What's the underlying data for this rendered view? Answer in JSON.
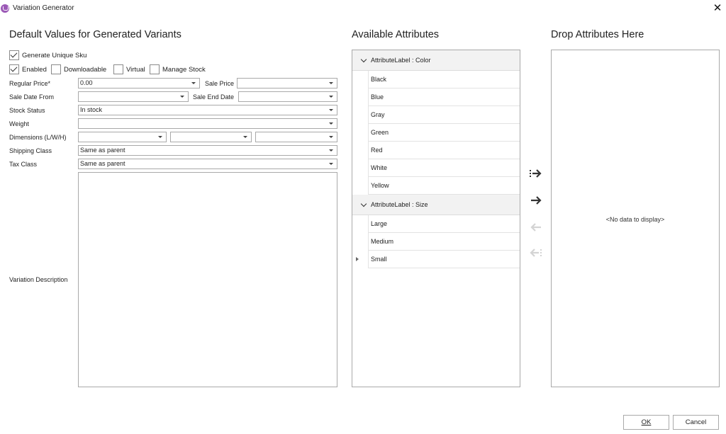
{
  "window": {
    "title": "Variation Generator",
    "icon": "app-logo-icon",
    "close_icon": "close-icon"
  },
  "defaults": {
    "title": "Default Values for Generated Variants",
    "generate_unique_sku": {
      "label": "Generate Unique Sku",
      "checked": true
    },
    "enabled": {
      "label": "Enabled",
      "checked": true
    },
    "downloadable": {
      "label": "Downloadable",
      "checked": false
    },
    "virtual": {
      "label": "Virtual",
      "checked": false
    },
    "manage_stock": {
      "label": "Manage Stock",
      "checked": false
    },
    "regular_price": {
      "label": "Regular Price*",
      "value": "0.00"
    },
    "sale_price": {
      "label": "Sale Price",
      "value": ""
    },
    "sale_date_from": {
      "label": "Sale Date From",
      "value": ""
    },
    "sale_end_date": {
      "label": "Sale End Date",
      "value": ""
    },
    "stock_status": {
      "label": "Stock Status",
      "value": "In stock"
    },
    "weight": {
      "label": "Weight",
      "value": ""
    },
    "dimensions": {
      "label": "Dimensions (L/W/H)",
      "length": "",
      "width": "",
      "height": ""
    },
    "shipping_class": {
      "label": "Shipping Class",
      "value": "Same as parent"
    },
    "tax_class": {
      "label": "Tax Class",
      "value": "Same as parent"
    },
    "variation_description": {
      "label": "Variation Description",
      "value": ""
    }
  },
  "available": {
    "title": "Available Attributes",
    "groups": [
      {
        "label": "AttributeLabel : Color",
        "items": [
          "Black",
          "Blue",
          "Gray",
          "Green",
          "Red",
          "White",
          "Yellow"
        ]
      },
      {
        "label": "AttributeLabel : Size",
        "items": [
          "Large",
          "Medium",
          "Small"
        ]
      }
    ]
  },
  "transfer": {
    "add_all_icon": "move-all-right-icon",
    "add_icon": "move-right-icon",
    "remove_icon": "move-left-icon",
    "remove_all_icon": "move-all-left-icon"
  },
  "drop": {
    "title": "Drop Attributes Here",
    "empty_text": "<No data to display>"
  },
  "footer": {
    "ok_label": "OK",
    "cancel_label": "Cancel"
  }
}
